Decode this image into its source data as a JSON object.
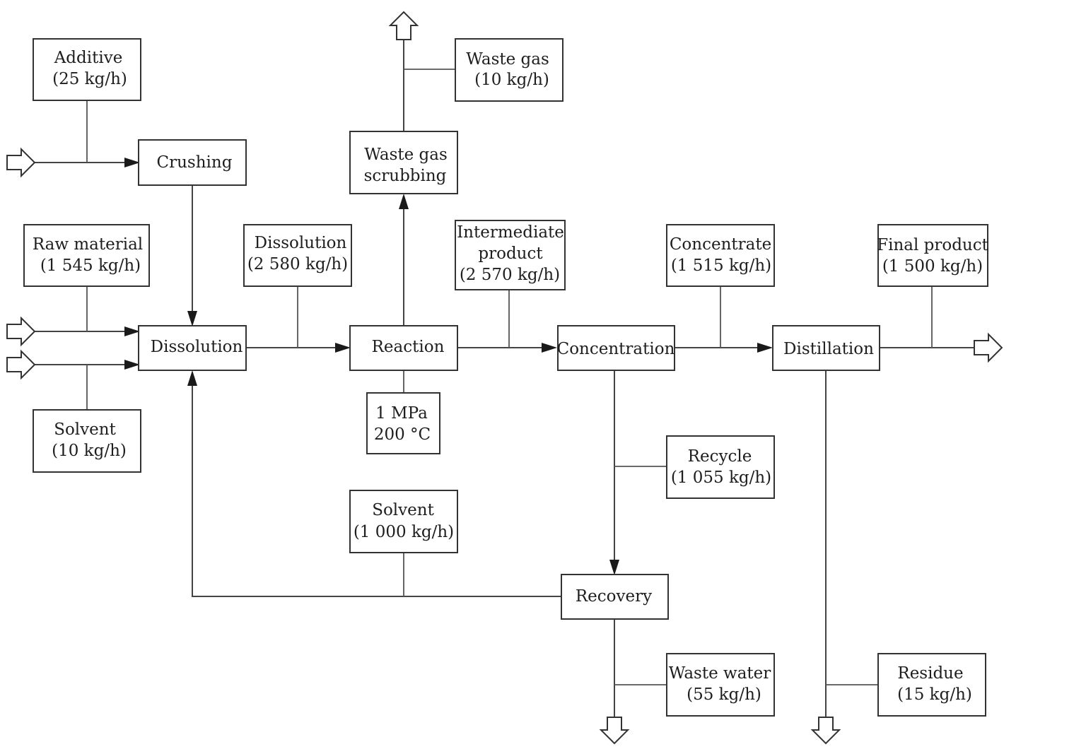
{
  "diagram": {
    "type": "process flow diagram",
    "process_steps": {
      "crushing": "Crushing",
      "dissolution": "Dissolution",
      "reaction": "Reaction",
      "waste_gas_scrubbing": [
        "Waste gas",
        "scrubbing"
      ],
      "concentration": "Concentration",
      "distillation": "Distillation",
      "recovery": "Recovery"
    },
    "streams": {
      "additive": [
        "Additive",
        "(25 kg/h)"
      ],
      "raw_material": [
        "Raw material",
        "(1 545 kg/h)"
      ],
      "solvent_in": [
        "Solvent",
        "(10 kg/h)"
      ],
      "dissolution_out": [
        "Dissolution",
        "(2 580 kg/h)"
      ],
      "waste_gas": [
        "Waste gas",
        "(10 kg/h)"
      ],
      "intermediate_product": [
        "Intermediate",
        "product",
        "(2 570 kg/h)"
      ],
      "reaction_conditions": [
        "1 MPa",
        "200 °C"
      ],
      "concentrate": [
        "Concentrate",
        "(1 515 kg/h)"
      ],
      "final_product": [
        "Final product",
        "(1 500 kg/h)"
      ],
      "recycle": [
        "Recycle",
        "(1 055 kg/h)"
      ],
      "solvent_recovered": [
        "Solvent",
        "(1 000 kg/h)"
      ],
      "waste_water": [
        "Waste water",
        "(55 kg/h)"
      ],
      "residue": [
        "Residue",
        "(15 kg/h)"
      ]
    },
    "connections": [
      {
        "from": "feed",
        "to": "Crushing",
        "label": "Additive (25 kg/h)"
      },
      {
        "from": "Crushing",
        "to": "Dissolution"
      },
      {
        "from": "feed",
        "to": "Dissolution",
        "label": "Raw material (1 545 kg/h)"
      },
      {
        "from": "feed",
        "to": "Dissolution",
        "label": "Solvent (10 kg/h)"
      },
      {
        "from": "Dissolution",
        "to": "Reaction",
        "label": "Dissolution (2 580 kg/h)"
      },
      {
        "from": "Reaction",
        "to": "Waste gas scrubbing"
      },
      {
        "from": "Waste gas scrubbing",
        "to": "outlet",
        "label": "Waste gas (10 kg/h)"
      },
      {
        "from": "Reaction",
        "to": "Concentration",
        "label": "Intermediate product (2 570 kg/h)"
      },
      {
        "from": "Concentration",
        "to": "Distillation",
        "label": "Concentrate (1 515 kg/h)"
      },
      {
        "from": "Distillation",
        "to": "outlet",
        "label": "Final product (1 500 kg/h)"
      },
      {
        "from": "Concentration",
        "to": "Recovery",
        "label": "Recycle (1 055 kg/h)"
      },
      {
        "from": "Recovery",
        "to": "Dissolution",
        "label": "Solvent (1 000 kg/h)"
      },
      {
        "from": "Recovery",
        "to": "outlet",
        "label": "Waste water (55 kg/h)"
      },
      {
        "from": "Distillation",
        "to": "outlet",
        "label": "Residue (15 kg/h)"
      }
    ]
  }
}
